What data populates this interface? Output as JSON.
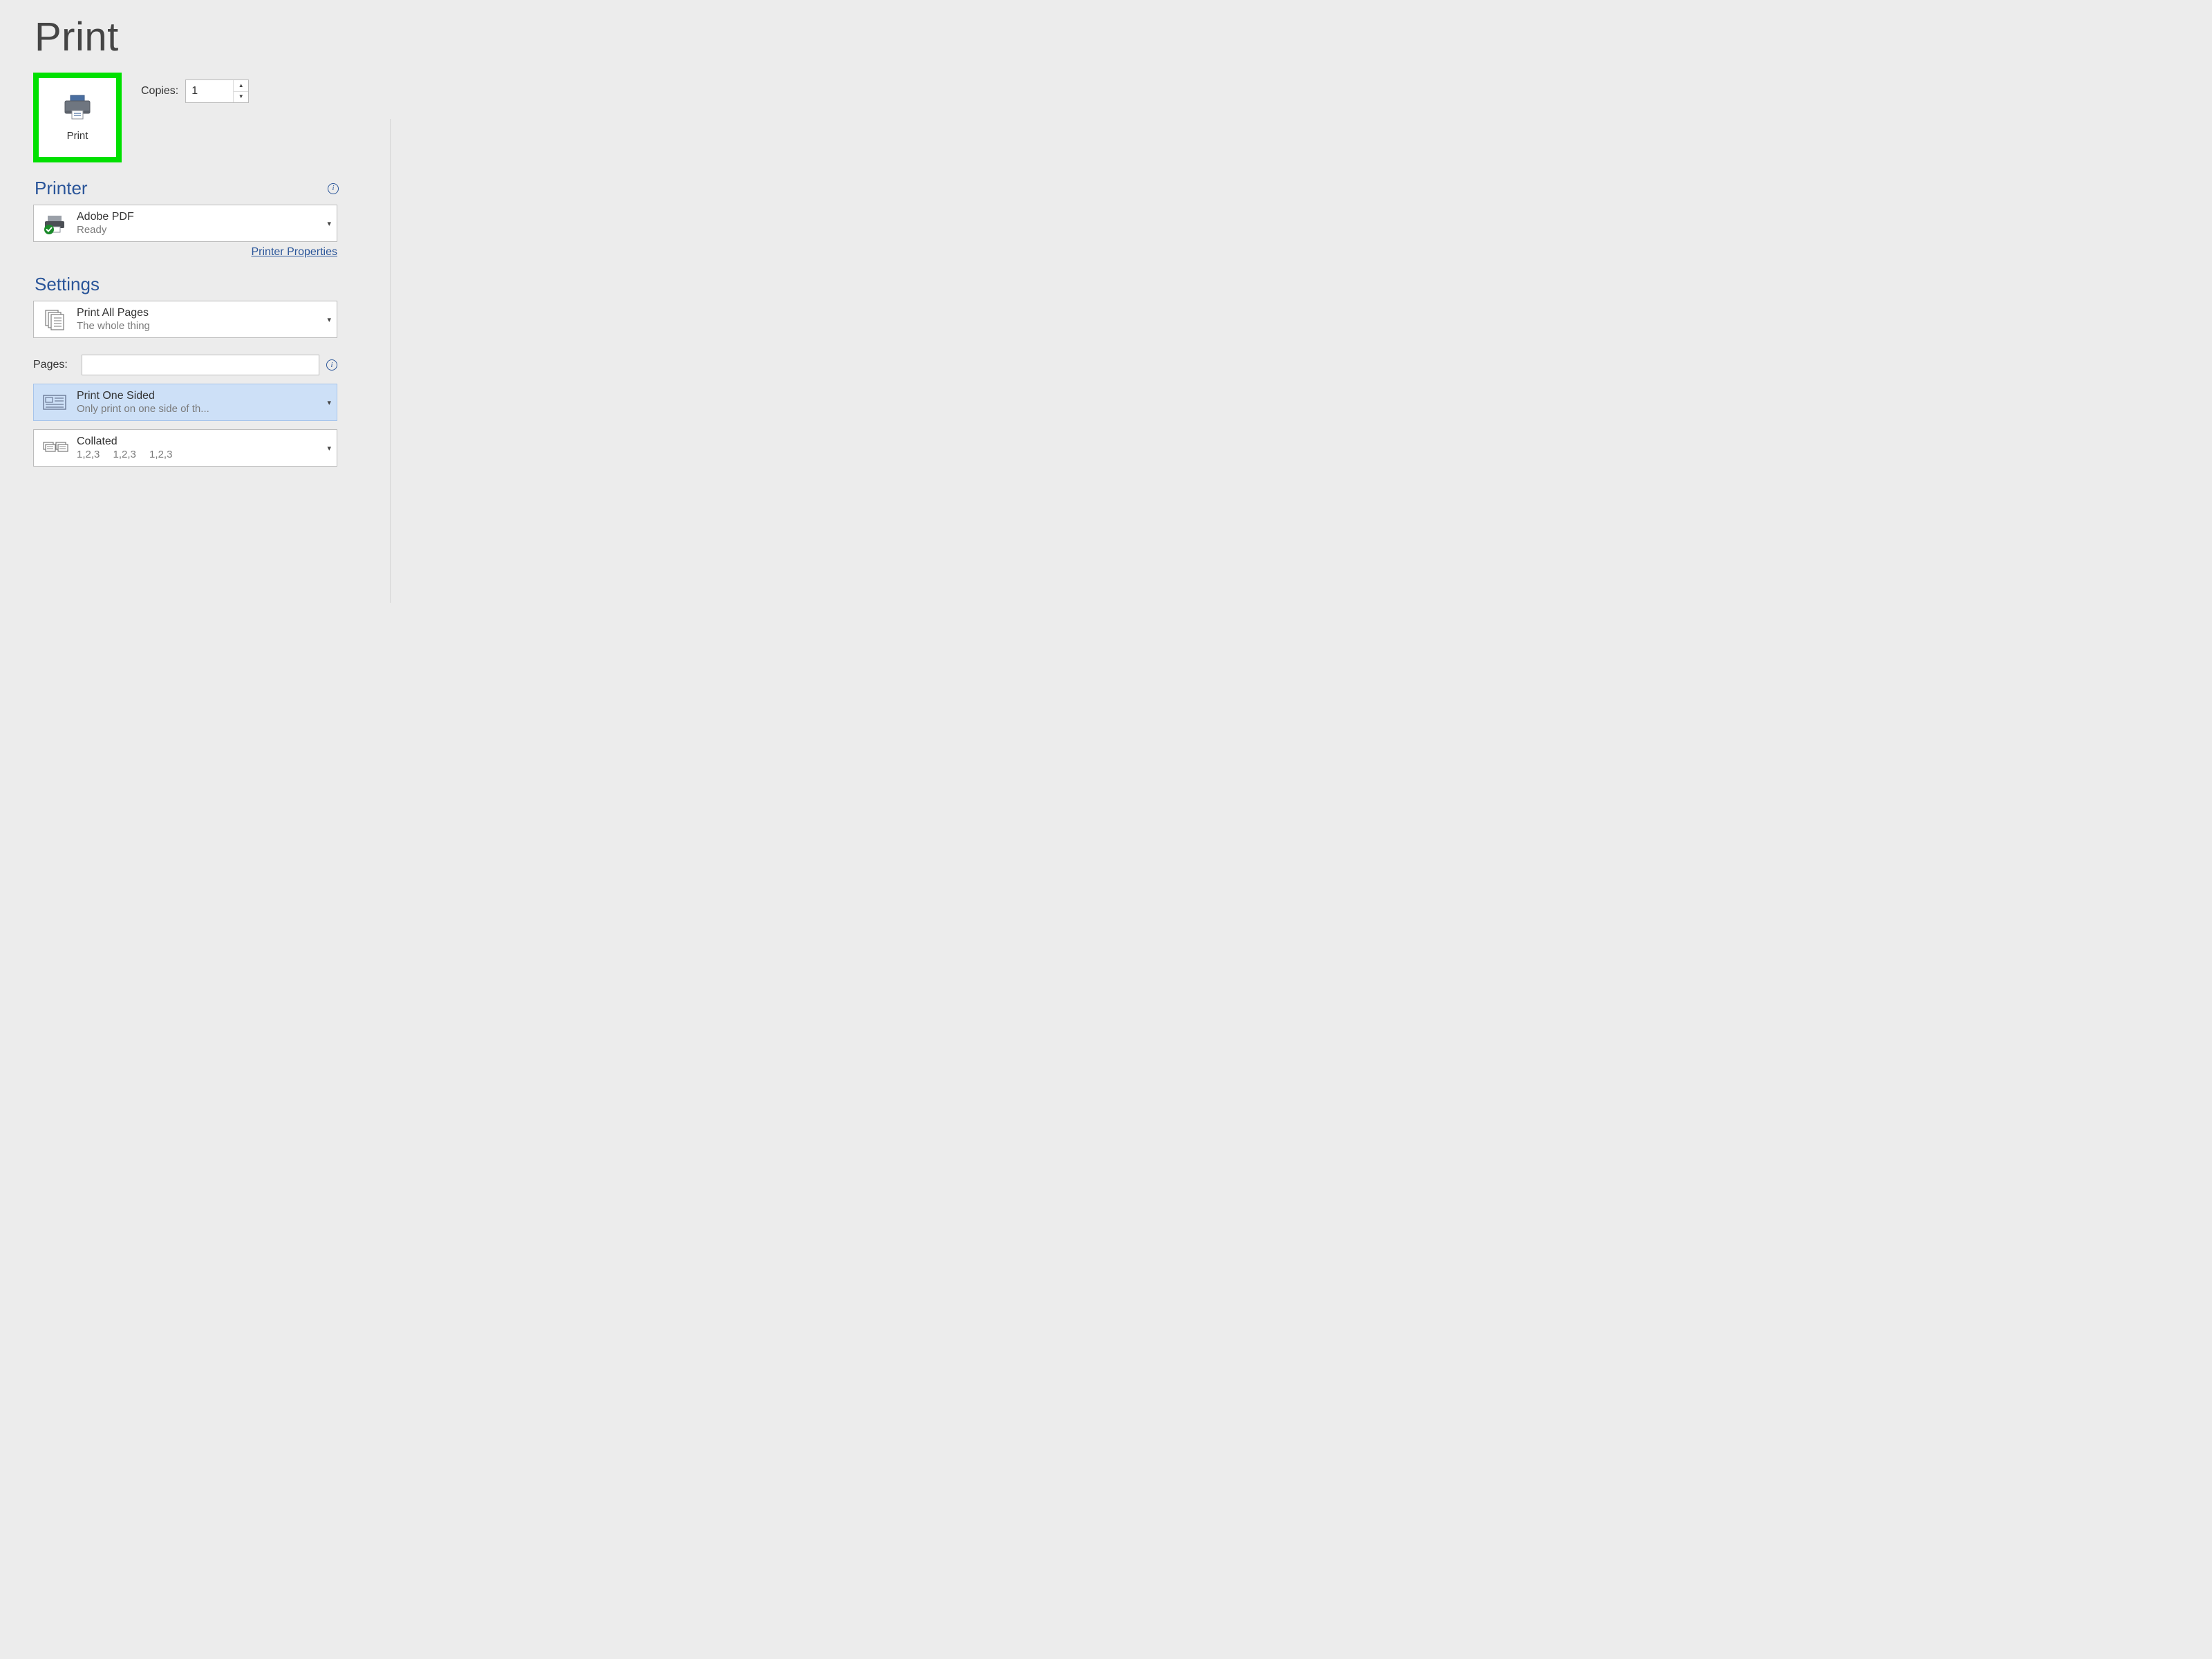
{
  "page": {
    "title": "Print"
  },
  "printButton": {
    "label": "Print"
  },
  "copies": {
    "label": "Copies:",
    "value": "1"
  },
  "sections": {
    "printer": "Printer",
    "settings": "Settings"
  },
  "printer": {
    "name": "Adobe PDF",
    "status": "Ready",
    "propertiesLink": "Printer Properties"
  },
  "settings": {
    "scope": {
      "line1": "Print All Pages",
      "line2": "The whole thing"
    },
    "pages": {
      "label": "Pages:",
      "value": ""
    },
    "sides": {
      "line1": "Print One Sided",
      "line2": "Only print on one side of th..."
    },
    "collate": {
      "line1": "Collated",
      "line2": "1,2,3  1,2,3  1,2,3"
    }
  },
  "icons": {
    "chevron": "▾",
    "spinUp": "▲",
    "spinDown": "▼",
    "info": "i"
  }
}
